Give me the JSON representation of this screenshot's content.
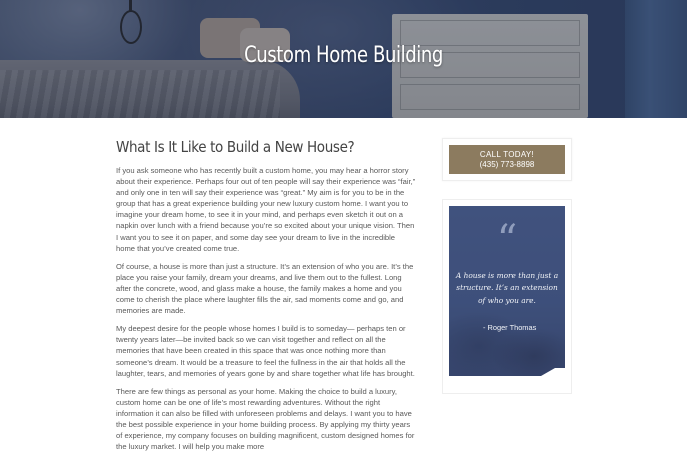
{
  "hero": {
    "title": "Custom Home Building"
  },
  "main": {
    "heading": "What Is It Like to Build a New House?",
    "paragraphs": [
      "If you ask someone who has recently built a custom home, you may hear a horror story about their experience. Perhaps four out of ten people will say their experience was “fair,” and only one in ten will say their experience was “great.” My aim is for you to be in the group that has a great experience building your new luxury custom home. I want you to imagine your dream home, to see it in your mind, and perhaps even sketch it out on a napkin over lunch with a friend because you’re so excited about your unique vision. Then I want you to see it on paper, and some day see your dream to live in the incredible home that you’ve created come true.",
      "Of course, a house is more than just a structure. It’s an extension of who you are. It’s the place you raise your family, dream your dreams, and live them out to the fullest. Long after the concrete, wood, and glass make a house, the family makes a home and you come to cherish the place where laughter fills the air, sad moments come and go, and memories are made.",
      "My deepest desire for the people whose homes I build is to someday— perhaps ten or twenty years later—be invited back so we can visit together and reflect on all the memories that have been created in this space that was once nothing more than someone’s dream. It would be a treasure to feel the fullness in the air that holds all the laughter, tears, and memories of years gone by and share together what life has brought.",
      "There are few things as personal as your home. Making the choice to build a luxury, custom home can be one of life’s most rewarding adventures. Without the right information it can also be filled with unforeseen problems and delays. I want you to have the best possible experience in your home building process. By applying my thirty years of experience, my company focuses on building magnificent, custom designed homes for the luxury market. I will help you make more"
    ]
  },
  "sidebar": {
    "call_line1": "CALL TODAY!",
    "call_line2": "(435) 773-8898",
    "quote_mark": "“",
    "quote_text": "A house is more than just a structure. It’s an extension of who you are.",
    "quote_author": "- Roger Thomas"
  },
  "colors": {
    "accent": "#8c7b5f",
    "hero_overlay": "#2f3a52",
    "text": "#5a5a5a",
    "heading": "#444444"
  }
}
